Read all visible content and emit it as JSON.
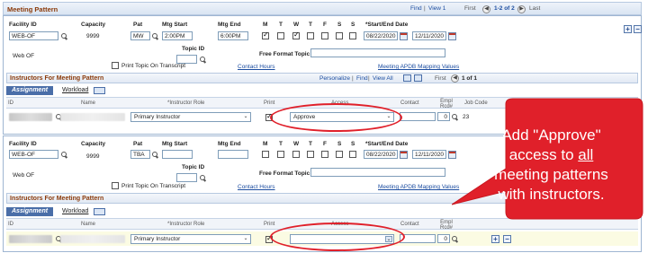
{
  "meeting_pattern": {
    "title": "Meeting Pattern",
    "nav": {
      "find": "Find",
      "view": "View 1",
      "first": "First",
      "range": "1-2 of 2",
      "last": "Last"
    },
    "labels": {
      "facility_id": "Facility ID",
      "capacity": "Capacity",
      "pat": "Pat",
      "mtg_start": "Mtg Start",
      "mtg_end": "Mtg End",
      "days": [
        "M",
        "T",
        "W",
        "T",
        "F",
        "S",
        "S"
      ],
      "start_end_date": "*Start/End Date",
      "topic_id": "Topic ID",
      "free_format_topic": "Free Format Topic",
      "print_topic": "Print Topic On Transcript",
      "contact_hours": "Contact Hours",
      "apdb_mapping": "Meeting APDB Mapping Values"
    }
  },
  "pattern1": {
    "facility": "WEB-OF",
    "capacity": "9999",
    "pat": "MW",
    "mtg_start": "2:00PM",
    "mtg_end": "6:00PM",
    "start_date": "08/22/2020",
    "end_date": "12/11/2020",
    "facility_desc": "Web  OF",
    "days_checked": [
      true,
      false,
      true,
      false,
      false,
      false,
      false
    ]
  },
  "pattern2": {
    "facility": "WEB-OF",
    "capacity": "9999",
    "pat": "TBA",
    "mtg_start": "",
    "mtg_end": "",
    "start_date": "08/22/2020",
    "end_date": "12/11/2020",
    "facility_desc": "Web  OF"
  },
  "instructors": {
    "title": "Instructors For Meeting Pattern",
    "nav": {
      "personalize": "Personalize",
      "find": "Find",
      "view_all": "View All",
      "first": "First",
      "range": "1 of 1",
      "last": "Last"
    },
    "tabs": {
      "assignment": "Assignment",
      "workload": "Workload"
    },
    "columns": {
      "id": "ID",
      "name": "Name",
      "role": "*Instructor Role",
      "print": "Print",
      "access": "Access",
      "contact": "Contact",
      "empl_rcd": "Empl Rcd#",
      "job_code": "Job Code"
    },
    "row1": {
      "role": "Primary Instructor",
      "access": "Approve",
      "empl_rcd": "0",
      "job_code": "23"
    },
    "row2": {
      "role": "Primary Instructor",
      "access": "",
      "empl_rcd": "0"
    }
  },
  "callout": {
    "line1": "Add \"Approve\"",
    "line2": "access to ",
    "line2_emph": "all",
    "line3": "meeting patterns",
    "line4": "with instructors."
  },
  "colors": {
    "accent_red": "#e0202a",
    "header_text": "#8b3a0a",
    "link": "#1c4da0"
  }
}
